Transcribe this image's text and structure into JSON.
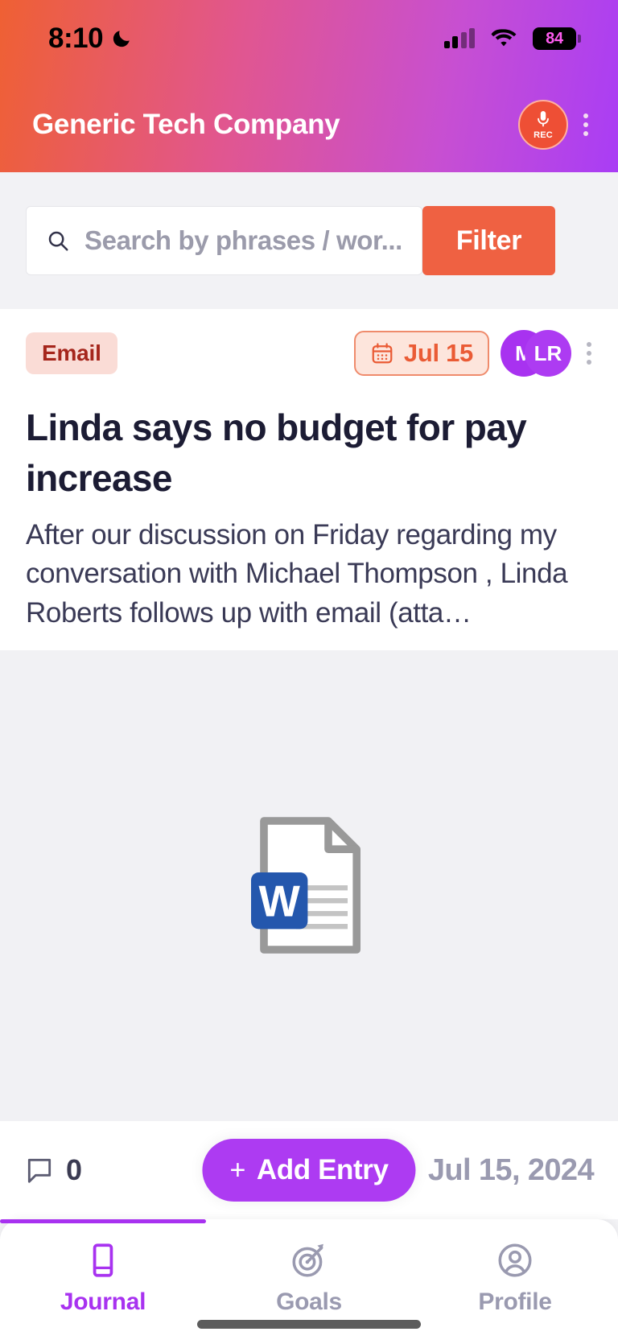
{
  "status_bar": {
    "time": "8:10",
    "moon_icon": "crescent-moon-icon",
    "signal_icon": "cellular-signal-icon",
    "wifi_icon": "wifi-icon",
    "battery_level": "84"
  },
  "app_bar": {
    "title": "Generic Tech Company",
    "record_button_label": "REC",
    "record_icon": "microphone-icon",
    "overflow_icon": "kebab-menu-icon"
  },
  "search": {
    "placeholder": "Search by phrases / wor...",
    "icon": "search-icon",
    "filter_label": "Filter"
  },
  "entry_card": {
    "tag": "Email",
    "date_chip": "Jul 15",
    "calendar_icon": "calendar-icon",
    "avatars": [
      {
        "initials": "M",
        "color": "#a832f0"
      },
      {
        "initials": "LR",
        "color": "#ad3bf2"
      }
    ],
    "overflow_icon": "kebab-menu-icon",
    "title": "Linda says no budget for pay increase",
    "body": "After our discussion on Friday regarding my conversation with Michael Thompson , Linda Roberts follows up with email (atta…",
    "attachment": {
      "icon": "word-document-icon",
      "badge_letter": "W",
      "badge_color": "#2457ad"
    },
    "comment_icon": "comment-bubble-icon",
    "comment_count": "0",
    "add_entry_label": "Add Entry",
    "add_entry_plus": "+",
    "footer_date": "Jul 15, 2024"
  },
  "bottom_nav": {
    "active_index": 0,
    "items": [
      {
        "label": "Journal",
        "icon": "book-icon"
      },
      {
        "label": "Goals",
        "icon": "target-dart-icon"
      },
      {
        "label": "Profile",
        "icon": "person-circle-icon"
      }
    ]
  },
  "colors": {
    "accent_purple": "#a832f0",
    "accent_orange": "#ef6142",
    "tag_bg": "#fadcd6",
    "tag_text": "#a5261c"
  }
}
